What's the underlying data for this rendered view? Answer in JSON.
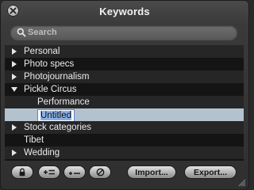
{
  "window": {
    "title": "Keywords"
  },
  "search": {
    "placeholder": "Search",
    "value": ""
  },
  "keywords": [
    {
      "label": "Personal",
      "expandable": true,
      "expanded": false,
      "depth": 0
    },
    {
      "label": "Photo specs",
      "expandable": true,
      "expanded": false,
      "depth": 0
    },
    {
      "label": "Photojournalism",
      "expandable": true,
      "expanded": false,
      "depth": 0
    },
    {
      "label": "Pickle Circus",
      "expandable": true,
      "expanded": true,
      "depth": 0
    },
    {
      "label": "Performance",
      "expandable": false,
      "expanded": false,
      "depth": 1
    },
    {
      "label": "Untitled",
      "expandable": false,
      "expanded": false,
      "depth": 1,
      "selected": true,
      "editing": true
    },
    {
      "label": "Stock categories",
      "expandable": true,
      "expanded": false,
      "depth": 0
    },
    {
      "label": "Tibet",
      "expandable": false,
      "expanded": false,
      "depth": 0
    },
    {
      "label": "Wedding",
      "expandable": true,
      "expanded": false,
      "depth": 0
    }
  ],
  "footer": {
    "icon_buttons": [
      "lock-icon",
      "add-keyword-icon",
      "add-subkeyword-icon",
      "delete-icon"
    ],
    "import_label": "Import...",
    "export_label": "Export..."
  },
  "colors": {
    "selection": "#b3c2cf",
    "edit_highlight": "#8bb1e6",
    "row_alt": "#262626",
    "list_bg": "#141414"
  }
}
